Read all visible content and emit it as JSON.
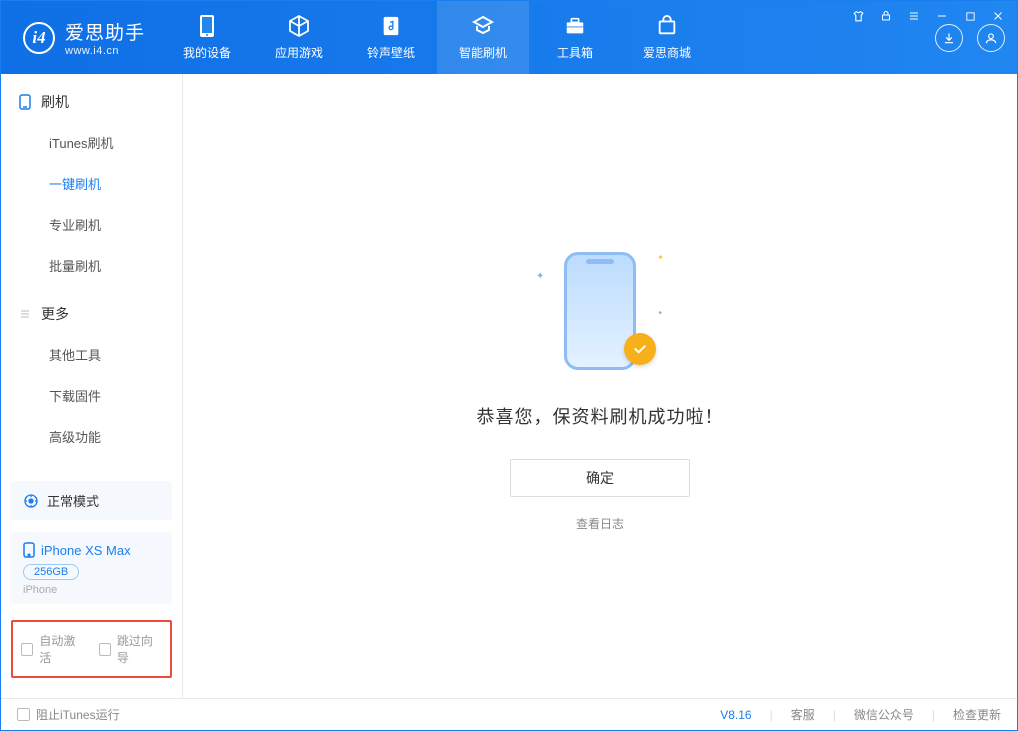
{
  "app": {
    "name_cn": "爱思助手",
    "name_en": "www.i4.cn"
  },
  "nav": {
    "items": [
      {
        "label": "我的设备",
        "icon": "device-icon"
      },
      {
        "label": "应用游戏",
        "icon": "cube-icon"
      },
      {
        "label": "铃声壁纸",
        "icon": "music-icon"
      },
      {
        "label": "智能刷机",
        "icon": "refresh-icon",
        "active": true
      },
      {
        "label": "工具箱",
        "icon": "toolbox-icon"
      },
      {
        "label": "爱思商城",
        "icon": "cart-icon"
      }
    ]
  },
  "sidebar": {
    "section1": {
      "title": "刷机",
      "icon": "phone-icon"
    },
    "items1": [
      {
        "label": "iTunes刷机"
      },
      {
        "label": "一键刷机",
        "active": true
      },
      {
        "label": "专业刷机"
      },
      {
        "label": "批量刷机"
      }
    ],
    "section2": {
      "title": "更多",
      "icon": "menu-icon"
    },
    "items2": [
      {
        "label": "其他工具"
      },
      {
        "label": "下载固件"
      },
      {
        "label": "高级功能"
      }
    ]
  },
  "device": {
    "mode_label": "正常模式",
    "name": "iPhone XS Max",
    "storage": "256GB",
    "platform": "iPhone"
  },
  "options": {
    "auto_activate": "自动激活",
    "skip_guide": "跳过向导"
  },
  "main": {
    "success_text": "恭喜您，保资料刷机成功啦！",
    "confirm": "确定",
    "view_log": "查看日志"
  },
  "status": {
    "block_itunes": "阻止iTunes运行",
    "version": "V8.16",
    "support": "客服",
    "wechat": "微信公众号",
    "check_update": "检查更新"
  }
}
